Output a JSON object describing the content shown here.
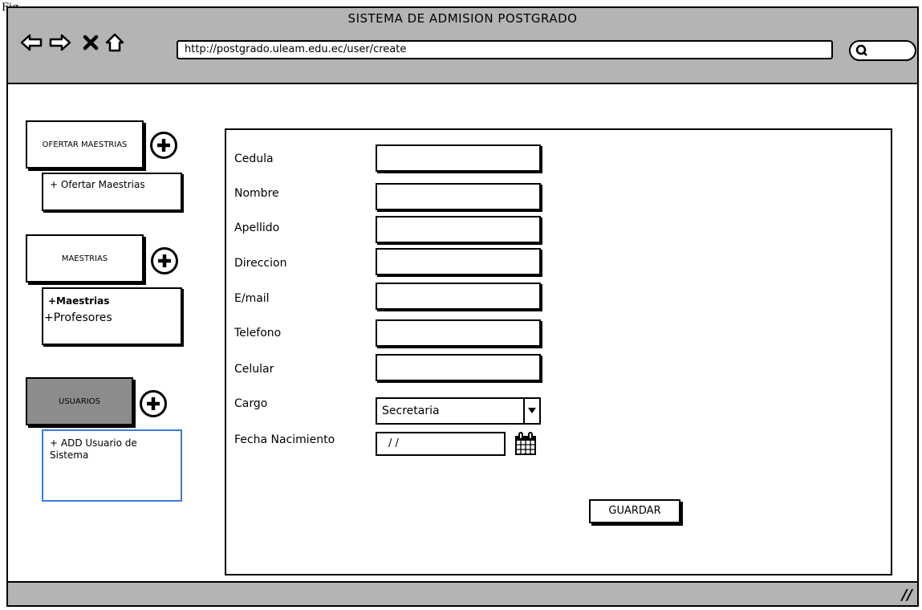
{
  "figure_label": "Fig",
  "window": {
    "title": "SISTEMA DE ADMISION POSTGRADO",
    "url": "http://postgrado.uleam.edu.ec/user/create",
    "nav_icons": [
      "back-arrow-icon",
      "forward-arrow-icon",
      "close-x-icon",
      "home-icon"
    ],
    "status_glyph": "//"
  },
  "sidebar": {
    "groups": [
      {
        "label": "OFERTAR MAESTRIAS",
        "items": [
          "+ Ofertar Maestrias"
        ]
      },
      {
        "label": "MAESTRIAS",
        "items": [
          "+Maestrias",
          "+Profesores"
        ]
      },
      {
        "label": "USUARIOS",
        "items": [
          "+ ADD Usuario de Sistema"
        ],
        "active": true
      }
    ]
  },
  "form": {
    "labels": {
      "cedula": "Cedula",
      "nombre": "Nombre",
      "apellido": "Apellido",
      "direccion": "Direccion",
      "email": "E/mail",
      "telefono": "Telefono",
      "celular": "Celular",
      "cargo": "Cargo",
      "fecha": "Fecha Nacimiento"
    },
    "cargo_value": "Secretaria",
    "fecha_value": "/ /",
    "save_label": "GUARDAR"
  },
  "colors": {
    "chrome_gray": "#b4b4b4",
    "active_menu": "#8c8c8c",
    "selected_border": "#3b7be0"
  }
}
